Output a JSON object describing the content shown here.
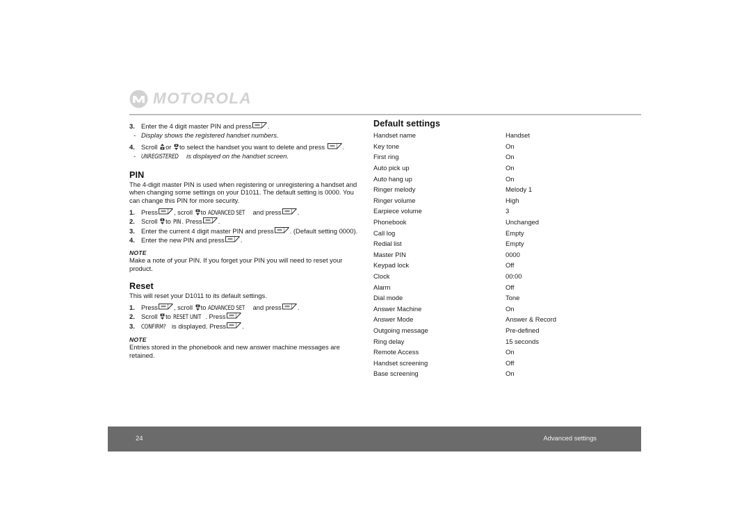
{
  "brand": {
    "name": "MOTOROLA",
    "logo_icon": "motorola-m-logo"
  },
  "left_column": {
    "continued_steps": [
      {
        "num": "3.",
        "text_before": "Enter the 4 digit master PIN and press",
        "icon": "softkey-menu-icon",
        "text_after": "."
      },
      {
        "num": "4.",
        "text_before": "Scroll",
        "icon_up": "nav-up-icon",
        "text_mid": "or",
        "icon_down": "nav-down-icon",
        "text_after": "to select the handset you want to delete and press",
        "icon_end": "softkey-menu-icon",
        "text_end": "."
      }
    ],
    "sub_note_1": "Display shows the registered handset numbers.",
    "sub_note_2_lcd": "UNREGISTERED",
    "sub_note_2_rest": "is displayed on the handset screen.",
    "pin": {
      "heading": "PIN",
      "body": "The 4-digit master PIN is used when registering or unregistering a handset and when changing some settings on your D1011. The default setting is 0000. You can change this PIN for more security.",
      "steps": [
        {
          "num": "1.",
          "t1": "Press",
          "i1": "softkey-menu-icon",
          "t2": ", scroll",
          "i2": "nav-down-icon",
          "t3": "to",
          "lcd": "ADVANCED SET",
          "t4": "and press",
          "i3": "softkey-menu-icon",
          "t5": "."
        },
        {
          "num": "2.",
          "t1": "Scroll",
          "i1": "nav-down-icon",
          "t2": "to",
          "lcd": "PIN",
          "t3": ". Press",
          "i2": "softkey-menu-icon",
          "t4": "."
        },
        {
          "num": "3.",
          "t1": "Enter the current 4 digit master PIN and press",
          "i1": "softkey-menu-icon",
          "t2": ". (Default setting 0000)."
        },
        {
          "num": "4.",
          "t1": "Enter the new PIN and press",
          "i1": "softkey-menu-icon",
          "t2": "."
        }
      ],
      "note_label": "NOTE",
      "note_body": "Make a note of your PIN. If you forget your PIN you will need to reset your product."
    },
    "reset": {
      "heading": "Reset",
      "body": "This will reset your D1011 to its default settings.",
      "steps": [
        {
          "num": "1.",
          "t1": "Press",
          "i1": "softkey-menu-icon",
          "t2": ", scroll",
          "i2": "nav-down-icon",
          "t3": "to",
          "lcd": "ADVANCED SET",
          "t4": "and press",
          "i3": "softkey-menu-icon",
          "t5": "."
        },
        {
          "num": "2.",
          "t1": "Scroll",
          "i1": "nav-down-icon",
          "t2": "to",
          "lcd": "RESET UNIT",
          "t3": ". Press",
          "i2": "softkey-menu-icon",
          "t4": ""
        },
        {
          "num": "3.",
          "lcd": "CONFIRM?",
          "t1": "is displayed. Press",
          "i1": "softkey-menu-icon",
          "t2": "."
        }
      ],
      "note_label": "NOTE",
      "note_body": "Entries stored in the phonebook and new answer machine messages are retained."
    }
  },
  "right_column": {
    "heading": "Default settings",
    "rows": [
      {
        "label": "Handset name",
        "value": "Handset"
      },
      {
        "label": "Key tone",
        "value": "On"
      },
      {
        "label": "First ring",
        "value": "On"
      },
      {
        "label": "Auto pick up",
        "value": "On"
      },
      {
        "label": "Auto hang up",
        "value": "On"
      },
      {
        "label": "Ringer melody",
        "value": "Melody 1"
      },
      {
        "label": "Ringer volume",
        "value": "High"
      },
      {
        "label": "Earpiece volume",
        "value": "3"
      },
      {
        "label": "Phonebook",
        "value": "Unchanged"
      },
      {
        "label": "Call log",
        "value": "Empty"
      },
      {
        "label": "Redial list",
        "value": "Empty"
      },
      {
        "label": "Master PIN",
        "value": "0000"
      },
      {
        "label": "Keypad lock",
        "value": "Off"
      },
      {
        "label": "Clock",
        "value": "00:00"
      },
      {
        "label": "Alarm",
        "value": "Off"
      },
      {
        "label": "Dial mode",
        "value": "Tone"
      },
      {
        "label": "Answer Machine",
        "value": "On"
      },
      {
        "label": "Answer Mode",
        "value": "Answer & Record"
      },
      {
        "label": "Outgoing message",
        "value": "Pre-defined"
      },
      {
        "label": "Ring delay",
        "value": "15 seconds"
      },
      {
        "label": "Remote Access",
        "value": "On"
      },
      {
        "label": "Handset screening",
        "value": "Off"
      },
      {
        "label": "Base screening",
        "value": "On"
      }
    ]
  },
  "footer": {
    "page_number": "24",
    "section_title": "Advanced settings",
    "bar_color": "#6b6b6b"
  }
}
